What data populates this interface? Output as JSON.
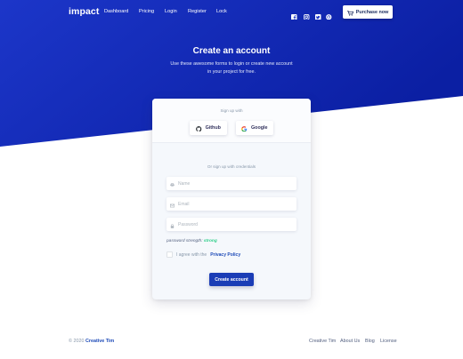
{
  "colors": {
    "hero_start": "#1a35c8",
    "hero_end": "#0a1f9e",
    "accent": "#1a3db6",
    "strength": "#2dce89"
  },
  "navbar": {
    "brand": "impact",
    "links": [
      "Dashboard",
      "Pricing",
      "Login",
      "Register",
      "Lock"
    ],
    "social_icons": [
      "facebook-icon",
      "instagram-icon",
      "twitter-icon",
      "github-icon"
    ],
    "purchase_label": "Purchase now",
    "purchase_icon": "cart-icon"
  },
  "hero": {
    "title": "Create an account",
    "subtitle": "Use these awesome forms to login or create new account in your project for free."
  },
  "card": {
    "signup_with": "Sign up with",
    "github_label": "Github",
    "google_label": "Google",
    "or_credentials": "Or sign up with credentials",
    "name_placeholder": "Name",
    "email_placeholder": "Email",
    "password_placeholder": "Password",
    "strength_prefix": "password strength: ",
    "strength_value": "strong",
    "agree_text": "I agree with the",
    "privacy_link": "Privacy Policy",
    "create_label": "Create account"
  },
  "footer": {
    "copyright": "© 2020",
    "brand": "Creative Tim",
    "links": [
      "Creative Tim",
      "About Us",
      "Blog",
      "License"
    ]
  }
}
